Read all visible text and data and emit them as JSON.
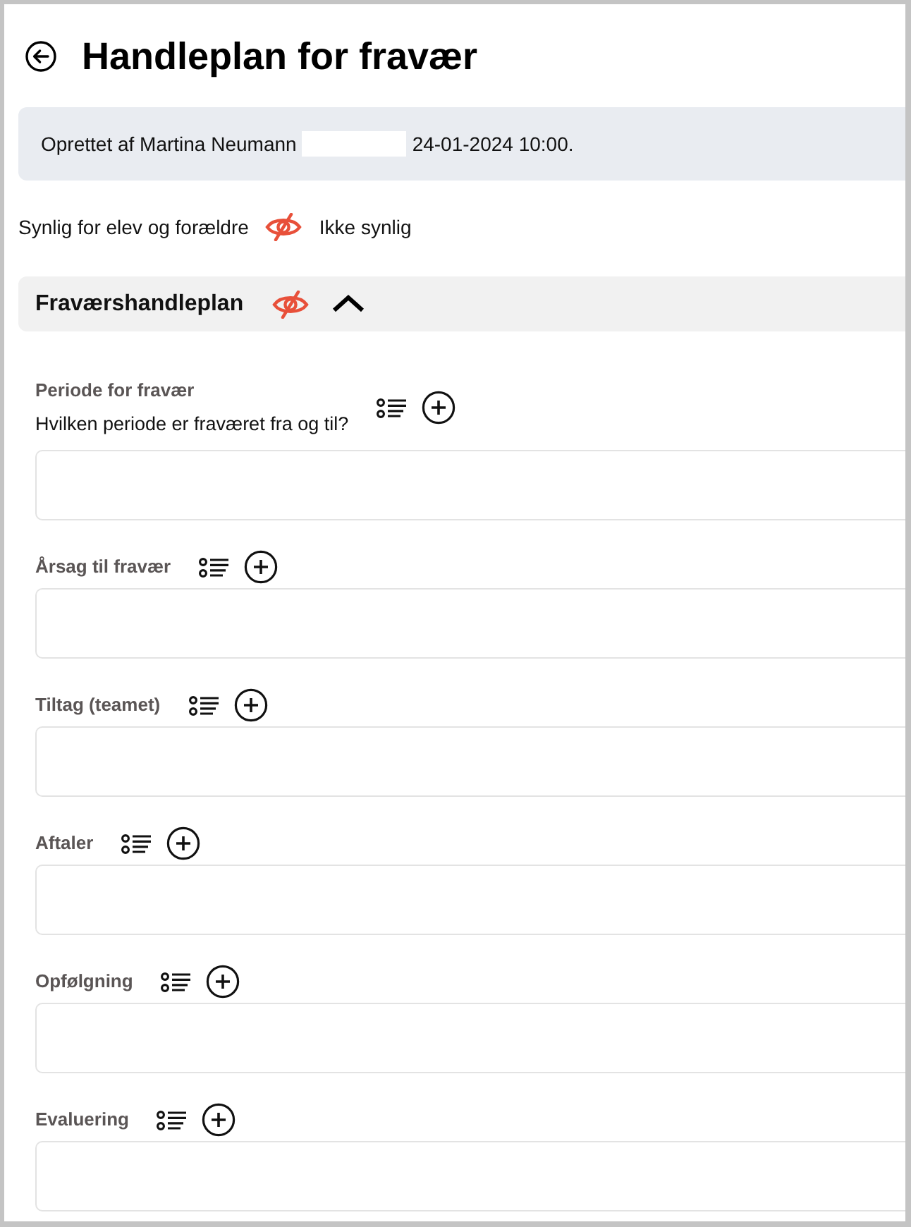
{
  "page": {
    "title": "Handleplan for fravær"
  },
  "info": {
    "created_by": "Oprettet af Martina Neumann",
    "created_at": "24-01-2024 10:00."
  },
  "visibility": {
    "label": "Synlig for elev og forældre",
    "visible": false,
    "status": "Ikke synlig"
  },
  "section": {
    "title": "Fraværshandleplan",
    "visible": false,
    "expanded": true,
    "fields": [
      {
        "label": "Periode for fravær",
        "hint": "Hvilken periode er fraværet fra og til?"
      },
      {
        "label": "Årsag til fravær"
      },
      {
        "label": "Tiltag (teamet)"
      },
      {
        "label": "Aftaler"
      },
      {
        "label": "Opfølgning"
      },
      {
        "label": "Evaluering"
      }
    ]
  }
}
